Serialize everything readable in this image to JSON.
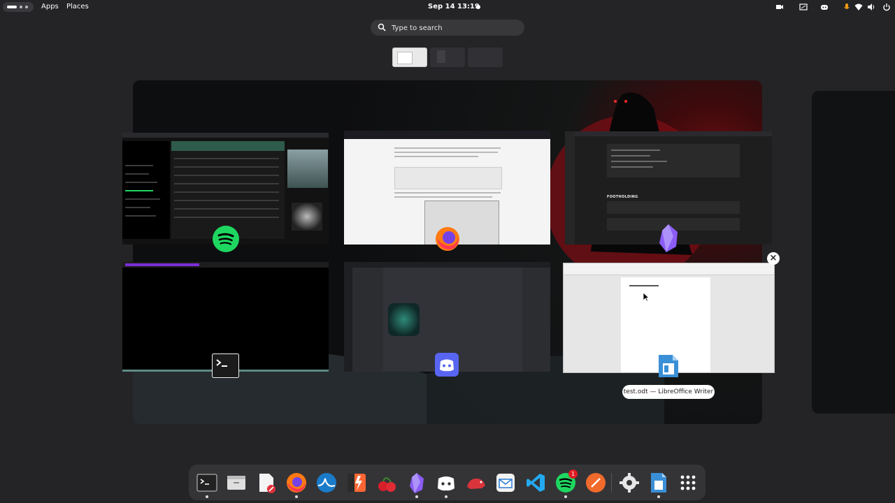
{
  "topbar": {
    "apps_label": "Apps",
    "places_label": "Places",
    "clock": "Sep 14  13:19"
  },
  "search": {
    "placeholder": "Type to search"
  },
  "workspaces": {
    "count": 3,
    "active": 1
  },
  "windows": [
    {
      "app": "Spotify",
      "icon": "spotify-icon"
    },
    {
      "app": "Firefox",
      "icon": "firefox-icon"
    },
    {
      "app": "Obsidian",
      "icon": "obsidian-icon",
      "heading": "FOOTHOLDING"
    },
    {
      "app": "Terminal",
      "icon": "terminal-icon"
    },
    {
      "app": "Discord",
      "icon": "discord-icon"
    },
    {
      "app": "LibreOffice Writer",
      "icon": "libreoffice-writer-icon",
      "title": "test.odt — LibreOffice Writer"
    }
  ],
  "dock": {
    "items": [
      {
        "name": "terminal",
        "running": true
      },
      {
        "name": "files",
        "running": false
      },
      {
        "name": "text-editor",
        "running": false
      },
      {
        "name": "firefox",
        "running": true
      },
      {
        "name": "wireshark",
        "running": false
      },
      {
        "name": "burp-suite",
        "running": false
      },
      {
        "name": "cherrytree",
        "running": false
      },
      {
        "name": "obsidian",
        "running": true
      },
      {
        "name": "discord",
        "running": true
      },
      {
        "name": "rat-app",
        "running": false
      },
      {
        "name": "mail",
        "running": false
      },
      {
        "name": "vscode",
        "running": false
      },
      {
        "name": "spotify",
        "running": true,
        "badge": "1"
      },
      {
        "name": "pen-tool",
        "running": false
      },
      {
        "name": "settings",
        "running": false
      },
      {
        "name": "libreoffice-writer",
        "running": true
      },
      {
        "name": "show-apps",
        "running": false
      }
    ]
  },
  "colors": {
    "topbar": "#242427",
    "dock": "#343437",
    "spotify": "#1ed760",
    "discord": "#5865f2",
    "obsidian": "#7c3aed"
  }
}
